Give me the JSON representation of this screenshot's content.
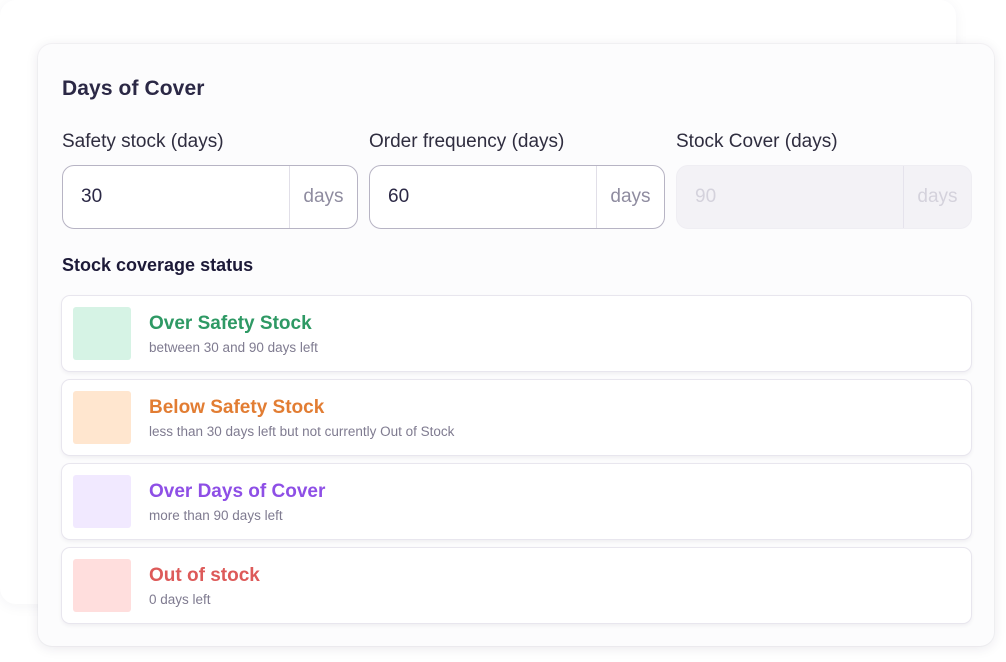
{
  "card": {
    "title": "Days of Cover"
  },
  "fields": [
    {
      "label": "Safety stock (days)",
      "value": "30",
      "suffix": "days",
      "disabled": false
    },
    {
      "label": "Order frequency (days)",
      "value": "60",
      "suffix": "days",
      "disabled": false
    },
    {
      "label": "Stock Cover (days)",
      "value": "90",
      "suffix": "days",
      "disabled": true
    }
  ],
  "coverage": {
    "title": "Stock coverage status",
    "statuses": [
      {
        "name": "Over Safety Stock",
        "description": "between 30 and 90 days left",
        "color": "#2e9964",
        "swatch": "#d6f3e5"
      },
      {
        "name": "Below Safety Stock",
        "description": "less than 30 days left but not currently Out of Stock",
        "color": "#e27d33",
        "swatch": "#ffe6cf"
      },
      {
        "name": "Over Days of Cover",
        "description": "more than 90 days left",
        "color": "#8e4fe6",
        "swatch": "#f1e9ff"
      },
      {
        "name": "Out of stock",
        "description": "0 days left",
        "color": "#dd5a59",
        "swatch": "#ffdedd"
      }
    ]
  }
}
